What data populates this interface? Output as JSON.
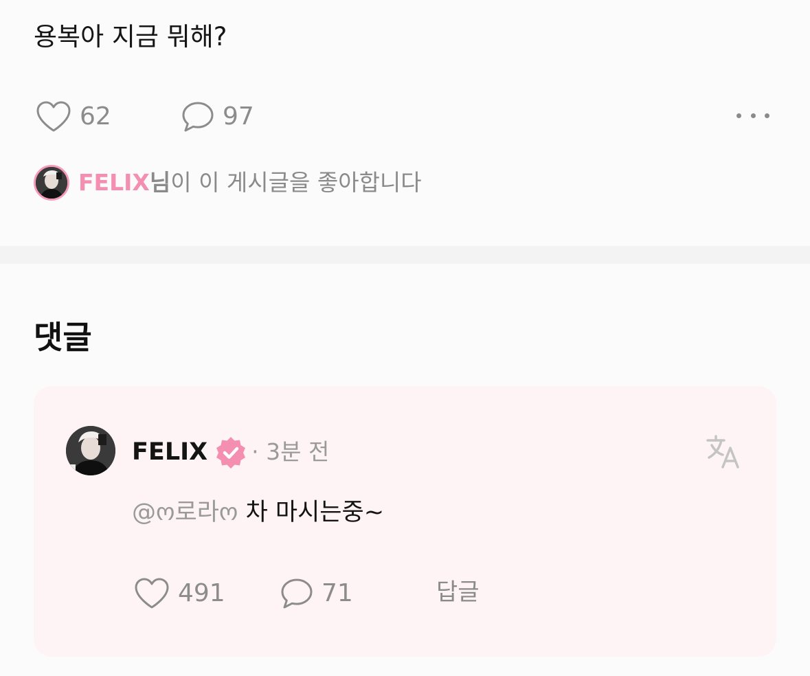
{
  "post": {
    "text": "용복아 지금 뭐해?",
    "likes": "62",
    "comments": "97",
    "liked_by": {
      "name": "FELIX",
      "suffix": "님",
      "rest": "이 이 게시글을 좋아합니다"
    }
  },
  "comments_section": {
    "heading": "댓글",
    "comment": {
      "author": "FELIX",
      "time": "· 3분 전",
      "mention": "@ო로라ო",
      "body": " 차 마시는중~",
      "likes": "491",
      "replies": "71",
      "reply_label": "답글"
    }
  },
  "icons": {
    "heart": "heart-icon",
    "comment": "comment-bubble-icon",
    "more": "more-horizontal-icon",
    "verified": "verified-badge-icon",
    "translate": "translate-icon"
  },
  "colors": {
    "accent_pink": "#f48fb1",
    "card_background": "#fef4f6",
    "muted_text": "#8a8a8a"
  }
}
